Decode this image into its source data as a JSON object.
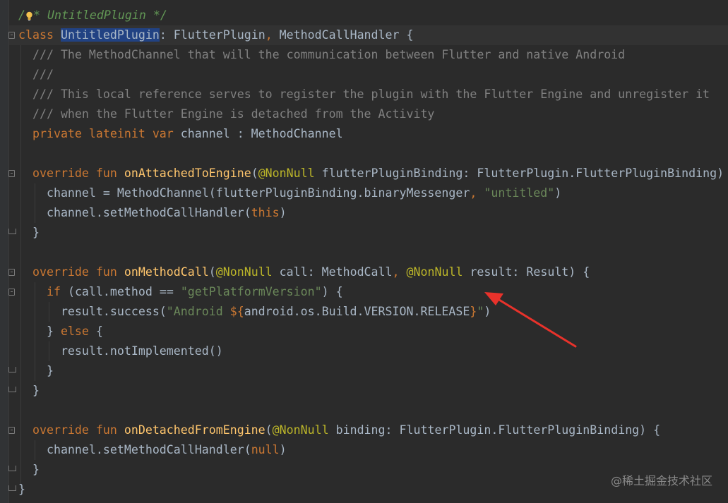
{
  "editor": {
    "lines": [
      {
        "segments": [
          {
            "t": "/",
            "c": "cmi"
          },
          {
            "t": "* UntitledPlugin */",
            "c": "cmi"
          }
        ]
      },
      {
        "segments": [
          {
            "t": "class ",
            "c": "kw"
          },
          {
            "t": "UntitledPlugin",
            "c": "sel"
          },
          {
            "t": ": FlutterPlugin",
            "c": "id"
          },
          {
            "t": ", ",
            "c": "kw"
          },
          {
            "t": "MethodCallHandler {",
            "c": "id"
          }
        ]
      },
      {
        "segments": [
          {
            "t": "  /// The MethodChannel that will the communication between Flutter and native Android",
            "c": "cm"
          }
        ]
      },
      {
        "segments": [
          {
            "t": "  ///",
            "c": "cm"
          }
        ]
      },
      {
        "segments": [
          {
            "t": "  /// This local reference serves to register the plugin with the Flutter Engine and unregister it",
            "c": "cm"
          }
        ]
      },
      {
        "segments": [
          {
            "t": "  /// when the Flutter Engine is detached from the Activity",
            "c": "cm"
          }
        ]
      },
      {
        "segments": [
          {
            "t": "  private lateinit var ",
            "c": "kw"
          },
          {
            "t": "channel : MethodChannel",
            "c": "id"
          }
        ]
      },
      {
        "segments": [
          {
            "t": "",
            "c": "id"
          }
        ]
      },
      {
        "segments": [
          {
            "t": "  override fun ",
            "c": "kw"
          },
          {
            "t": "onAttachedToEngine",
            "c": "fn"
          },
          {
            "t": "(",
            "c": "id"
          },
          {
            "t": "@NonNull ",
            "c": "an"
          },
          {
            "t": "flutterPluginBinding: FlutterPlugin.FlutterPluginBinding) {",
            "c": "id"
          }
        ]
      },
      {
        "segments": [
          {
            "t": "    channel = MethodChannel(flutterPluginBinding.binaryMessenger",
            "c": "id"
          },
          {
            "t": ", ",
            "c": "kw"
          },
          {
            "t": "\"untitled\"",
            "c": "st"
          },
          {
            "t": ")",
            "c": "id"
          }
        ]
      },
      {
        "segments": [
          {
            "t": "    channel.setMethodCallHandler(",
            "c": "id"
          },
          {
            "t": "this",
            "c": "kw"
          },
          {
            "t": ")",
            "c": "id"
          }
        ]
      },
      {
        "segments": [
          {
            "t": "  }",
            "c": "id"
          }
        ]
      },
      {
        "segments": [
          {
            "t": "",
            "c": "id"
          }
        ]
      },
      {
        "segments": [
          {
            "t": "  override fun ",
            "c": "kw"
          },
          {
            "t": "onMethodCall",
            "c": "fn"
          },
          {
            "t": "(",
            "c": "id"
          },
          {
            "t": "@NonNull ",
            "c": "an"
          },
          {
            "t": "call: MethodCall",
            "c": "id"
          },
          {
            "t": ", ",
            "c": "kw"
          },
          {
            "t": "@NonNull ",
            "c": "an"
          },
          {
            "t": "result: Result) {",
            "c": "id"
          }
        ]
      },
      {
        "segments": [
          {
            "t": "    ",
            "c": "id"
          },
          {
            "t": "if ",
            "c": "kw"
          },
          {
            "t": "(call.method == ",
            "c": "id"
          },
          {
            "t": "\"getPlatformVersion\"",
            "c": "st"
          },
          {
            "t": ") {",
            "c": "id"
          }
        ]
      },
      {
        "segments": [
          {
            "t": "      result.success(",
            "c": "id"
          },
          {
            "t": "\"Android ",
            "c": "st"
          },
          {
            "t": "${",
            "c": "kw"
          },
          {
            "t": "android.os.Build.VERSION.RELEASE",
            "c": "id"
          },
          {
            "t": "}",
            "c": "kw"
          },
          {
            "t": "\"",
            "c": "st"
          },
          {
            "t": ")",
            "c": "id"
          }
        ]
      },
      {
        "segments": [
          {
            "t": "    } ",
            "c": "id"
          },
          {
            "t": "else ",
            "c": "kw"
          },
          {
            "t": "{",
            "c": "id"
          }
        ]
      },
      {
        "segments": [
          {
            "t": "      result.notImplemented()",
            "c": "id"
          }
        ]
      },
      {
        "segments": [
          {
            "t": "    }",
            "c": "id"
          }
        ]
      },
      {
        "segments": [
          {
            "t": "  }",
            "c": "id"
          }
        ]
      },
      {
        "segments": [
          {
            "t": "",
            "c": "id"
          }
        ]
      },
      {
        "segments": [
          {
            "t": "  override fun ",
            "c": "kw"
          },
          {
            "t": "onDetachedFromEngine",
            "c": "fn"
          },
          {
            "t": "(",
            "c": "id"
          },
          {
            "t": "@NonNull ",
            "c": "an"
          },
          {
            "t": "binding: FlutterPlugin.FlutterPluginBinding) {",
            "c": "id"
          }
        ]
      },
      {
        "segments": [
          {
            "t": "    channel.setMethodCallHandler(",
            "c": "id"
          },
          {
            "t": "null",
            "c": "kw"
          },
          {
            "t": ")",
            "c": "id"
          }
        ]
      },
      {
        "segments": [
          {
            "t": "  }",
            "c": "id"
          }
        ]
      },
      {
        "segments": [
          {
            "t": "}",
            "c": "id"
          }
        ]
      }
    ]
  },
  "watermark": "@稀土掘金技术社区",
  "colors": {
    "background": "#2b2b2b",
    "keyword": "#cc7832",
    "comment": "#808080",
    "function": "#ffc66d",
    "string": "#6a8759",
    "annotation": "#bbb529",
    "selection": "#214283",
    "arrow": "#e8322b"
  },
  "icons": [
    "lightbulb-icon",
    "fold-marker-icon",
    "red-arrow-annotation"
  ]
}
